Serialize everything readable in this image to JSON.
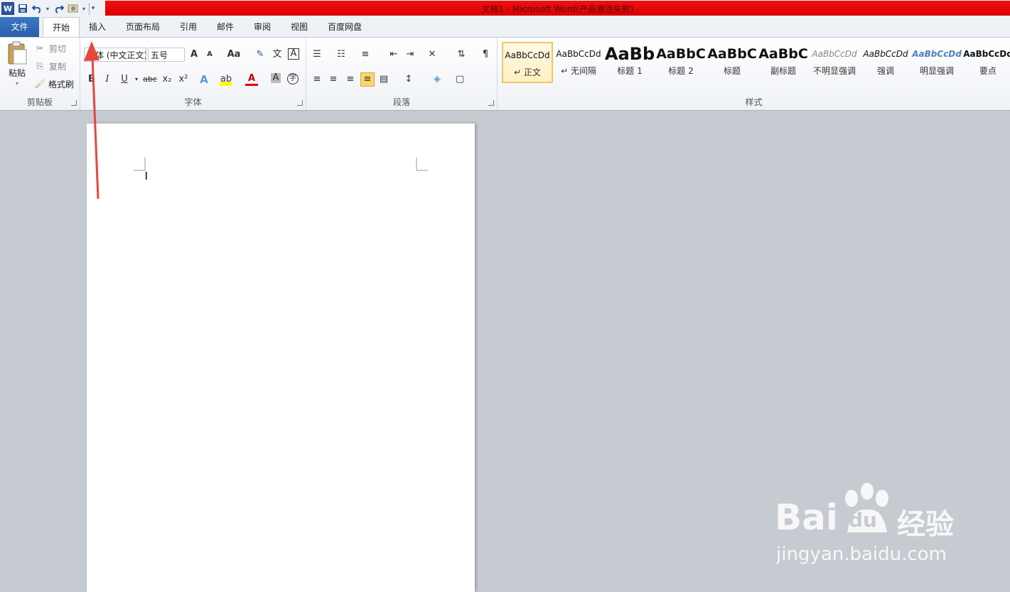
{
  "window": {
    "title": "文档1 - Microsoft Word(产品激活失败)"
  },
  "qat": {
    "logo": "W"
  },
  "tabs": [
    "文件",
    "开始",
    "插入",
    "页面布局",
    "引用",
    "邮件",
    "审阅",
    "视图",
    "百度网盘"
  ],
  "clipboard": {
    "paste": "粘贴",
    "cut": "剪切",
    "copy": "复制",
    "format_painter": "格式刷",
    "group": "剪贴板"
  },
  "font": {
    "name": "宋体 (中文正文)",
    "size": "五号",
    "group": "字体",
    "grow": "A",
    "shrink": "A",
    "case": "Aa",
    "bold": "B",
    "italic": "I",
    "underline": "U",
    "strike": "abc",
    "sub": "x₂",
    "sup": "x²"
  },
  "paragraph": {
    "group": "段落"
  },
  "styles": {
    "group": "样式",
    "items": [
      {
        "sample": "AaBbCcDd",
        "name": "↵ 正文"
      },
      {
        "sample": "AaBbCcDd",
        "name": "↵ 无间隔"
      },
      {
        "sample": "AaBb",
        "name": "标题 1"
      },
      {
        "sample": "AaBbC",
        "name": "标题 2"
      },
      {
        "sample": "AaBbC",
        "name": "标题"
      },
      {
        "sample": "AaBbC",
        "name": "副标题"
      },
      {
        "sample": "AaBbCcDd",
        "name": "不明显强调"
      },
      {
        "sample": "AaBbCcDd",
        "name": "强调"
      },
      {
        "sample": "AaBbCcDd",
        "name": "明显强调"
      },
      {
        "sample": "AaBbCcDd",
        "name": "要点"
      }
    ]
  },
  "watermark": {
    "brand": "Bai",
    "brand2": "du",
    "cn": "经验",
    "url": "jingyan.baidu.com"
  },
  "colors": {
    "title_red": "#e00000",
    "file_tab": "#2b579a",
    "arrow": "#e8453c",
    "selected_style": "#f2c65e"
  }
}
